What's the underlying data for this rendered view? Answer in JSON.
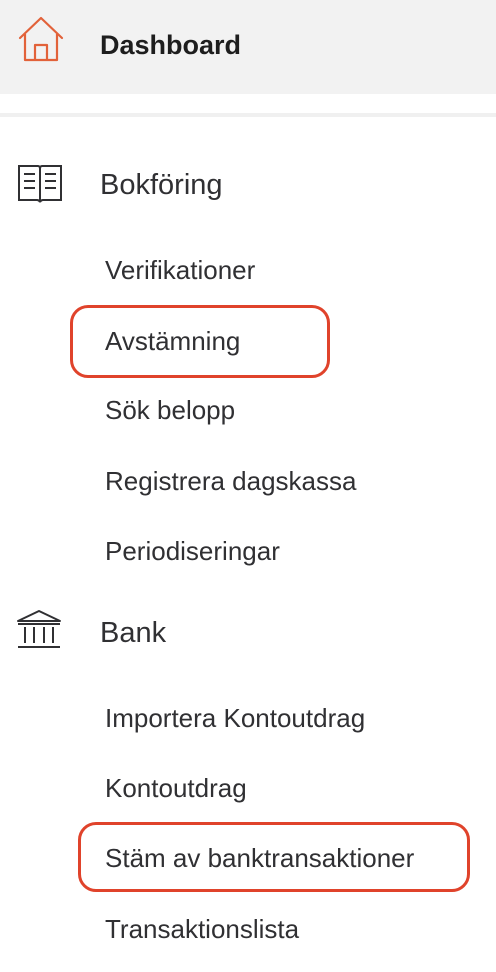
{
  "dashboard": {
    "label": "Dashboard",
    "icon": "home-icon",
    "icon_color": "#e2623a"
  },
  "bokforing": {
    "label": "Bokföring",
    "icon": "book-icon",
    "items": [
      {
        "label": "Verifikationer"
      },
      {
        "label": "Avstämning",
        "highlighted": true
      },
      {
        "label": "Sök belopp"
      },
      {
        "label": "Registrera dagskassa"
      },
      {
        "label": "Periodiseringar"
      }
    ]
  },
  "bank": {
    "label": "Bank",
    "icon": "bank-icon",
    "items": [
      {
        "label": "Importera Kontoutdrag"
      },
      {
        "label": "Kontoutdrag"
      },
      {
        "label": "Stäm av banktransaktioner",
        "highlighted": true
      },
      {
        "label": "Transaktionslista"
      }
    ]
  },
  "colors": {
    "highlight": "#e0432b",
    "text": "#303033",
    "dashboard_bg": "#f2f2f2"
  }
}
